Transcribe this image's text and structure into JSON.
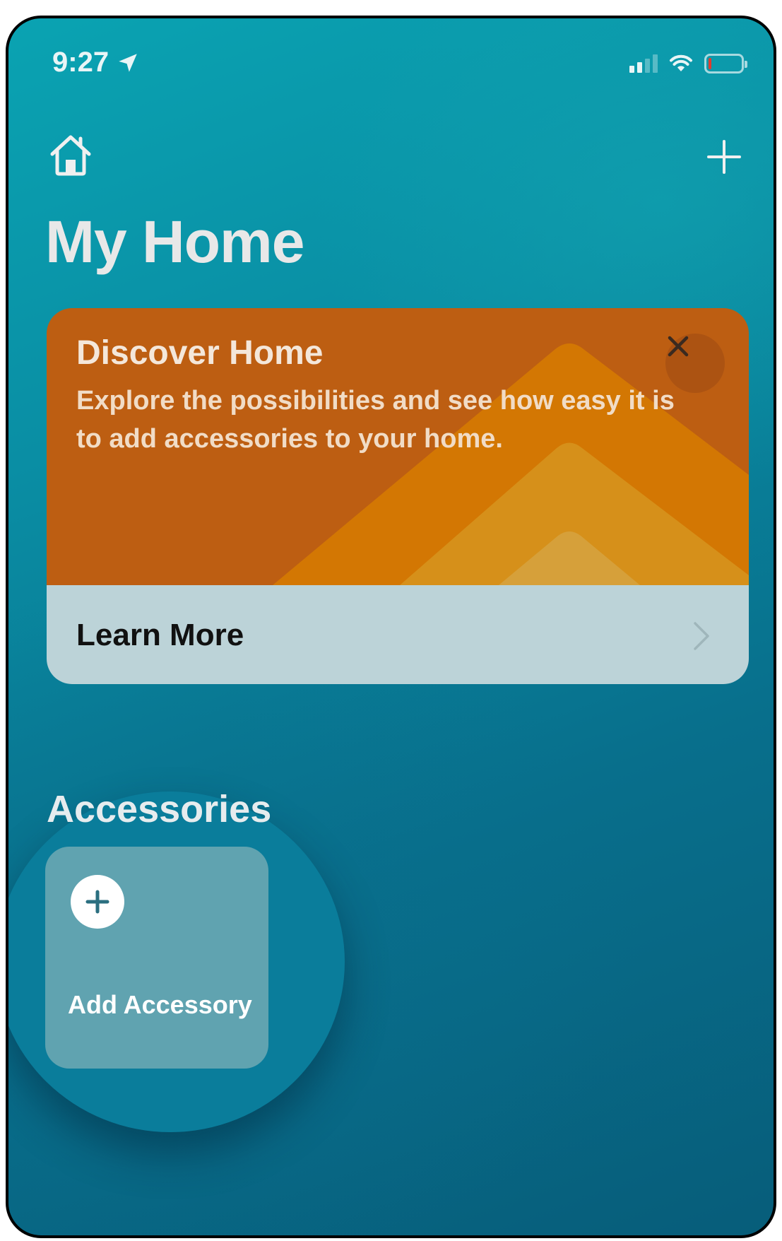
{
  "status_bar": {
    "time": "9:27",
    "location_icon": "location-arrow-icon",
    "signal_icon": "cellular-signal-icon",
    "wifi_icon": "wifi-icon",
    "battery_icon": "battery-low-icon"
  },
  "header": {
    "home_icon": "house-icon",
    "add_icon": "plus-icon",
    "title": "My Home"
  },
  "discover_card": {
    "title": "Discover Home",
    "description": "Explore the possibilities and see how easy it is to add accessories to your home.",
    "close_icon": "close-icon",
    "learn_more_label": "Learn More",
    "chevron_icon": "chevron-right-icon",
    "accent_color": "#bd5e12"
  },
  "accessories": {
    "section_title": "Accessories",
    "add_tile": {
      "icon": "plus-circle-icon",
      "label": "Add Accessory"
    }
  }
}
